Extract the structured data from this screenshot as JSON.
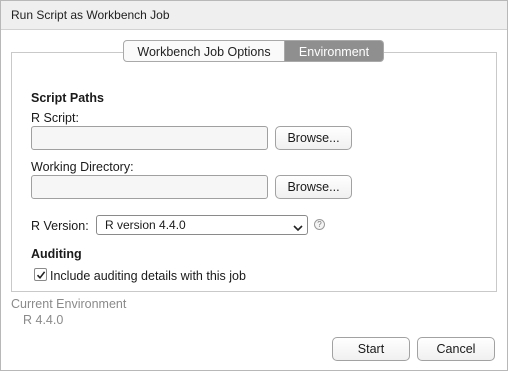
{
  "window": {
    "title": "Run Script as Workbench Job"
  },
  "tabs": [
    {
      "label": "Workbench Job Options",
      "active": false
    },
    {
      "label": "Environment",
      "active": true
    }
  ],
  "script_paths": {
    "heading": "Script Paths",
    "r_script_label": "R Script:",
    "r_script_value": "",
    "working_dir_label": "Working Directory:",
    "working_dir_value": "",
    "browse_label": "Browse..."
  },
  "r_version": {
    "label": "R Version:",
    "selected": "R version 4.4.0",
    "help": "?"
  },
  "auditing": {
    "heading": "Auditing",
    "checkbox_label": "Include auditing details with this job",
    "checked": true
  },
  "current_environment": {
    "label": "Current Environment",
    "value": "R 4.4.0"
  },
  "footer": {
    "start_label": "Start",
    "cancel_label": "Cancel"
  }
}
